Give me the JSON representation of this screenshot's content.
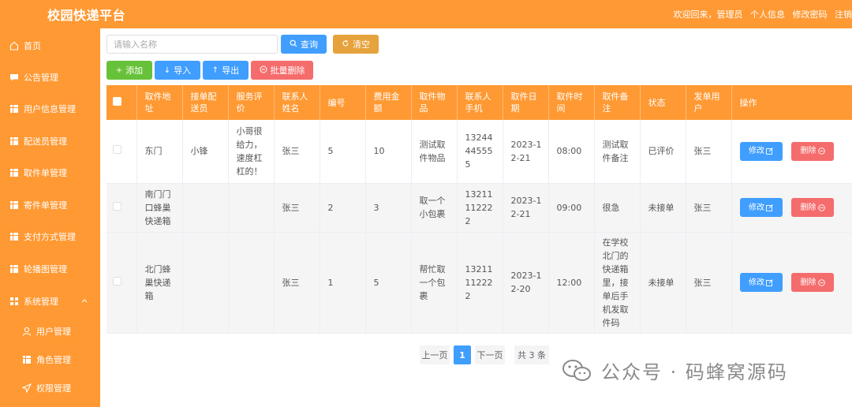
{
  "header": {
    "title": "校园快递平台",
    "welcome": "欢迎回来，管理员",
    "links": [
      "个人信息",
      "修改密码",
      "注销"
    ]
  },
  "sidebar": {
    "items": [
      {
        "label": "首页",
        "icon": "home-icon"
      },
      {
        "label": "公告管理",
        "icon": "message-icon"
      },
      {
        "label": "用户信息管理",
        "icon": "grid-icon"
      },
      {
        "label": "配送员管理",
        "icon": "grid-icon"
      },
      {
        "label": "取件单管理",
        "icon": "grid-icon"
      },
      {
        "label": "寄件单管理",
        "icon": "grid-icon"
      },
      {
        "label": "支付方式管理",
        "icon": "grid-icon"
      },
      {
        "label": "轮播图管理",
        "icon": "grid-icon"
      },
      {
        "label": "系统管理",
        "icon": "menu-icon"
      },
      {
        "label": "用户管理",
        "icon": "user-icon"
      },
      {
        "label": "角色管理",
        "icon": "grid-icon"
      },
      {
        "label": "权限管理",
        "icon": "send-icon"
      }
    ]
  },
  "toolbar": {
    "search_placeholder": "请输入名称",
    "search_label": "查询",
    "reset_label": "清空",
    "add_label": "添加",
    "import_label": "导入",
    "export_label": "导出",
    "batch_delete_label": "批量删除"
  },
  "table": {
    "headers": [
      "取件地址",
      "接单配送员",
      "服务评价",
      "联系人姓名",
      "编号",
      "费用金额",
      "取件物品",
      "联系人手机",
      "取件日期",
      "取件时间",
      "取件备注",
      "状态",
      "发单用户",
      "操作"
    ],
    "rows": [
      [
        "东门",
        "小锋",
        "小哥很给力，速度杠杠的！",
        "张三",
        "5",
        "10",
        "测试取件物品",
        "13244445555",
        "2023-12-21",
        "08:00",
        "测试取件备注",
        "已评价",
        "张三"
      ],
      [
        "南门门口蜂巢快递箱",
        "",
        "",
        "张三",
        "2",
        "3",
        "取一个小包裹",
        "13211112222",
        "2023-12-21",
        "09:00",
        "很急",
        "未接单",
        "张三"
      ],
      [
        "北门蜂巢快递箱",
        "",
        "",
        "张三",
        "1",
        "5",
        "帮忙取一个包裹",
        "13211112222",
        "2023-12-20",
        "12:00",
        "在学校北门的快递箱里，接单后手机发取件码",
        "未接单",
        "张三"
      ]
    ],
    "edit_label": "修改",
    "delete_label": "删除"
  },
  "pagination": {
    "prev": "上一页",
    "current": "1",
    "next": "下一页",
    "total": "共 3 条"
  },
  "watermark": {
    "text": "公众号 · 码蜂窝源码"
  },
  "colors": {
    "primary": "#ff9933",
    "blue": "#409eff",
    "red": "#f56c6c",
    "green": "#67c23a",
    "yellow": "#e6a23c"
  }
}
